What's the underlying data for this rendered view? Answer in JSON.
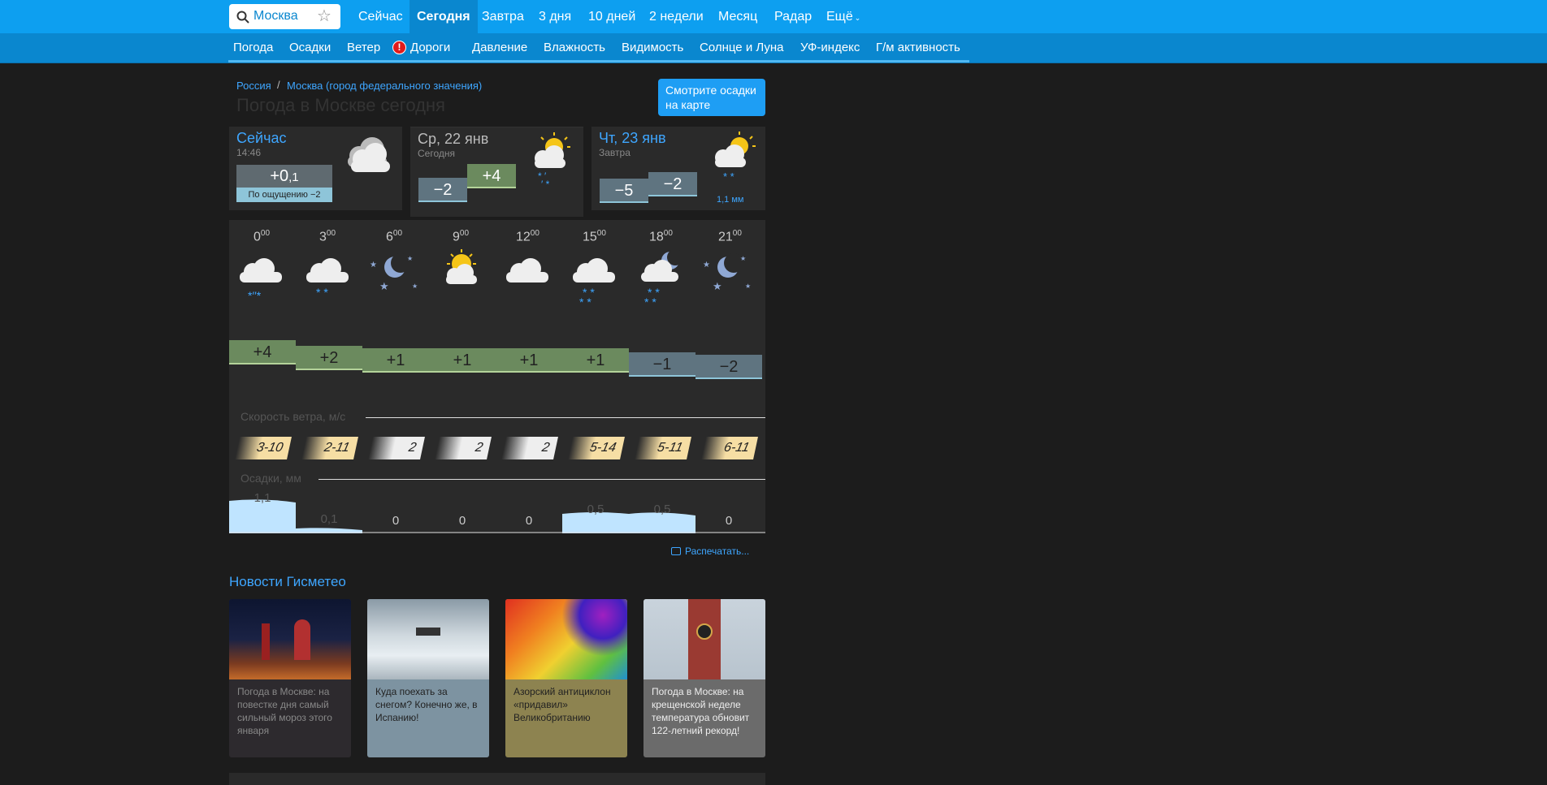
{
  "search": {
    "value": "Москва",
    "placeholder": "Москва"
  },
  "topnav": [
    "Сейчас",
    "Сегодня",
    "Завтра",
    "3 дня",
    "10 дней",
    "2 недели",
    "Месяц",
    "Радар",
    "Ещё"
  ],
  "subnav": [
    "Погода",
    "Осадки",
    "Ветер",
    "Дороги",
    "Давление",
    "Влажность",
    "Видимость",
    "Солнце и Луна",
    "УФ-индекс",
    "Г/м активность"
  ],
  "breadcrumb": [
    "Россия",
    "Москва (город федерального значения)"
  ],
  "page_title": "Погода в Москве сегодня",
  "map_button": "Смотрите осадки на карте",
  "now": {
    "title": "Сейчас",
    "time": "14:46",
    "temp_main": "+0",
    "temp_dec": ",1",
    "feels": "По ощущению −2"
  },
  "today": {
    "title": "Ср, 22 янв",
    "sub": "Сегодня",
    "tmin": "−2",
    "tmax": "+4"
  },
  "tomorrow": {
    "title": "Чт, 23 янв",
    "sub": "Завтра",
    "tmin": "−5",
    "tmax": "−2",
    "precip": "1,1 мм"
  },
  "hours": [
    "0",
    "3",
    "6",
    "9",
    "12",
    "15",
    "18",
    "21"
  ],
  "hours_min": "00",
  "temps": [
    "+4",
    "+2",
    "+1",
    "+1",
    "+1",
    "+1",
    "−1",
    "−2"
  ],
  "wind_label": "Скорость ветра, м/с",
  "wind": [
    "3-10",
    "2-11",
    "2",
    "2",
    "2",
    "5-14",
    "5-11",
    "6-11"
  ],
  "precip_label": "Осадки, мм",
  "precip": [
    "1,1",
    "0,1",
    "0",
    "0",
    "0",
    "0,5",
    "0,5",
    "0"
  ],
  "print": "Распечатать...",
  "news_title": "Новости Гисметео",
  "news": [
    "Погода в Москве: на повестке дня самый сильный мороз этого января",
    "Куда поехать за снегом? Конечно же, в Испанию!",
    "Азорский антициклон «придавил» Великобританию",
    "Погода в Москве: на крещенской неделе температура обновит 122-летний рекорд!"
  ],
  "colors": {
    "accent": "#0d9ff0",
    "link": "#3ea6ff",
    "warm": "#6b8a5e",
    "cold": "#5f7480"
  }
}
